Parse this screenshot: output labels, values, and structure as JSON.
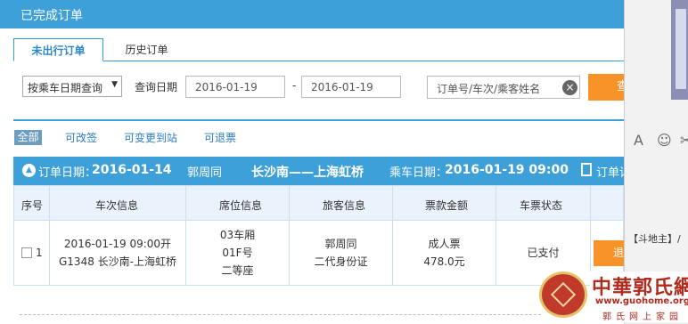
{
  "header": {
    "title": "已完成订单"
  },
  "tabs": [
    {
      "label": "未出行订单",
      "active": true
    },
    {
      "label": "历史订单",
      "active": false
    }
  ],
  "query": {
    "select_value": "按乘车日期查询",
    "date_label": "查询日期",
    "start_date": "2016-01-19",
    "separator": "-",
    "end_date": "2016-01-19",
    "search_placeholder": "订单号/车次/乘客姓名",
    "query_button": "查询"
  },
  "filters": {
    "all": "全部",
    "changeable": "可改签",
    "station_change": "可变更到站",
    "refundable": "可退票"
  },
  "order": {
    "order_date_label": "订单日期：",
    "order_date": "2016-01-14",
    "passenger_name": "郭周同",
    "route": "长沙南——上海虹桥",
    "ride_date_label": "乘车日期：",
    "ride_datetime": "2016-01-19 09:00",
    "detail_link": "订单详"
  },
  "table": {
    "headers": [
      "序号",
      "车次信息",
      "席位信息",
      "旅客信息",
      "票款金额",
      "车票状态"
    ],
    "rows": [
      {
        "index": "1",
        "train_line1": "2016-01-19 09:00开",
        "train_line2": "G1348 长沙南-上海虹桥",
        "seat_line1": "03车厢",
        "seat_line2": "01F号",
        "seat_line3": "二等座",
        "passenger_line1": "郭周同",
        "passenger_line2": "二代身份证",
        "price_line1": "成人票",
        "price_line2": "478.0元",
        "status": "已支付",
        "action": "退票"
      }
    ]
  },
  "side_panel": {
    "tools": [
      "A",
      "☺",
      "✂"
    ],
    "text": "【斗地主】/"
  },
  "watermark": {
    "name": "中華郭氏網",
    "url": "www.guohome.org",
    "slogan": "郭氏网上家园"
  },
  "colors": {
    "header_blue": "#3ea0d8",
    "accent_orange": "#f79328",
    "link_blue": "#2d7cc0"
  }
}
